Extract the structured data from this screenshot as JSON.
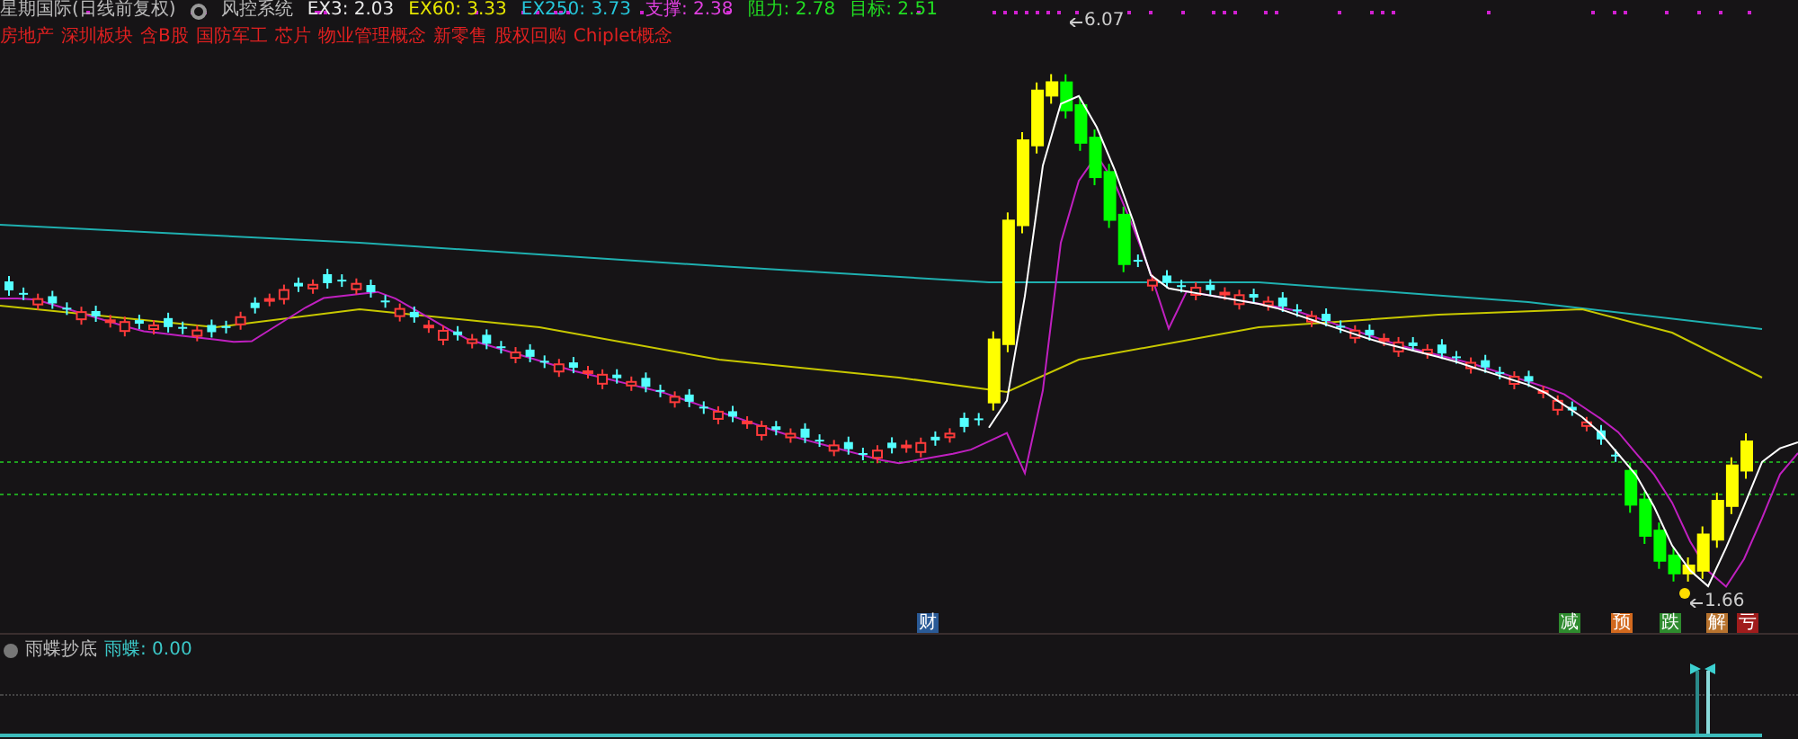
{
  "header": {
    "title": "星期国际(日线前复权)",
    "indicator": "风控系统",
    "values": [
      {
        "label": "EX3: 2.03",
        "color": "#e8e8e8"
      },
      {
        "label": "EX60: 3.33",
        "color": "#e6e600"
      },
      {
        "label": "EX250: 3.73",
        "color": "#26c6da"
      },
      {
        "label": "支撑: 2.38",
        "color": "#e040e0"
      },
      {
        "label": "阻力: 2.78",
        "color": "#22dd22"
      },
      {
        "label": "目标: 2.51",
        "color": "#22dd22"
      }
    ]
  },
  "tags": [
    "房地产",
    "深圳板块",
    "含B股",
    "国防军工",
    "芯片",
    "物业管理概念",
    "新零售",
    "股权回购",
    "Chiplet概念"
  ],
  "price_labels": {
    "high": "6.07",
    "low": "1.66"
  },
  "event_markers": [
    {
      "text": "财",
      "color": "#2a5a96"
    },
    {
      "text": "减",
      "color": "#2e8b2e"
    },
    {
      "text": "预",
      "color": "#d2691e"
    },
    {
      "text": "跌",
      "color": "#2e8b2e"
    },
    {
      "text": "解",
      "color": "#b8732e"
    },
    {
      "text": "亏",
      "color": "#a01c1c"
    }
  ],
  "subpanel": {
    "title": "雨蝶抄底",
    "value": "雨蝶: 0.00"
  }
}
